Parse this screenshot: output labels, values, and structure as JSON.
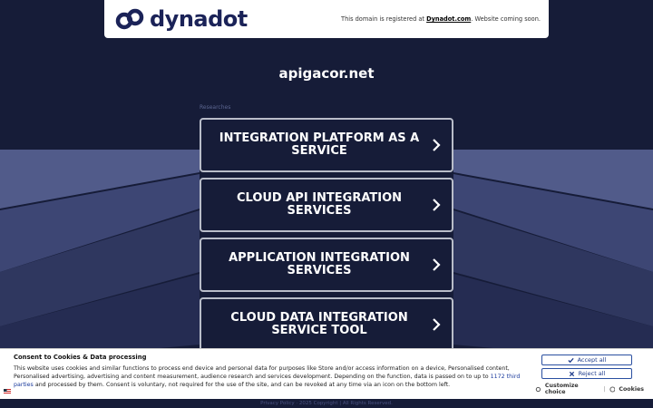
{
  "header": {
    "logo_text": "dynadot",
    "note_prefix": "This domain is registered at ",
    "note_link": "Dynadot.com",
    "note_suffix": ". Website coming soon."
  },
  "domain": "apigacor.net",
  "researches_label": "Researches",
  "links": [
    {
      "label": "INTEGRATION PLATFORM AS A SERVICE"
    },
    {
      "label": "CLOUD API INTEGRATION SERVICES"
    },
    {
      "label": "APPLICATION INTEGRATION SERVICES"
    },
    {
      "label": "CLOUD DATA INTEGRATION SERVICE TOOL"
    }
  ],
  "footer_text": "Privacy Policy · 2025 Copyright | All Rights Reserved.",
  "cookie": {
    "title": "Consent to Cookies & Data processing",
    "text_part1": "This website uses cookies and similar functions to process end device and personal data for purposes like Store and/or access information on a device, Personalised content, Personalised advertising, advertising and content measurement, audience research and services development. Depending on the function, data is passed on to up to ",
    "partner_count": "1172 third parties",
    "text_part2": " and processed by them. Consent is voluntary, not required for the use of the site, and can be revoked at any time via an icon on the bottom left.",
    "accept_label": "Accept all",
    "reject_label": "Reject all",
    "customize_label": "Customize choice",
    "cookies_label": "Cookies"
  },
  "colors": {
    "background": "#161c38",
    "brand": "#1b2358",
    "button_border": "#b9bdc9",
    "cookie_accent": "#2a4fa0"
  }
}
